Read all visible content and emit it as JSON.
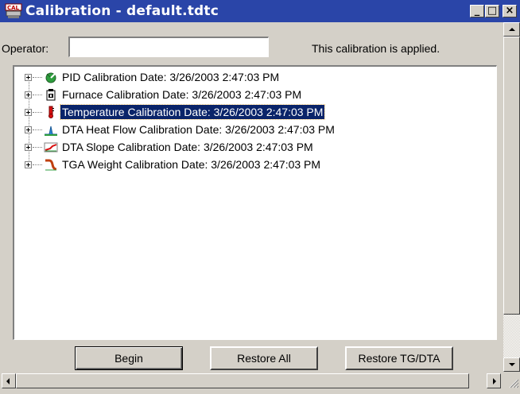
{
  "window": {
    "title": "Calibration - default.tdtc",
    "app_icon": "cal-app-icon",
    "controls": {
      "minimize": "_",
      "maximize": "□",
      "close": "×"
    }
  },
  "operator": {
    "label": "Operator:",
    "value": "",
    "placeholder": ""
  },
  "status_text": "This calibration is applied.",
  "tree": {
    "items": [
      {
        "label": "PID Calibration Date:  3/26/2003 2:47:03 PM",
        "icon": "pid-gauge-icon",
        "selected": false
      },
      {
        "label": "Furnace Calibration Date:  3/26/2003 2:47:03 PM",
        "icon": "furnace-icon",
        "selected": false
      },
      {
        "label": "Temperature Calibration Date:  3/26/2003 2:47:03 PM",
        "icon": "thermometer-icon",
        "selected": true
      },
      {
        "label": "DTA Heat Flow Calibration Date:  3/26/2003 2:47:03 PM",
        "icon": "heat-flow-icon",
        "selected": false
      },
      {
        "label": "DTA Slope Calibration Date:  3/26/2003 2:47:03 PM",
        "icon": "slope-icon",
        "selected": false
      },
      {
        "label": "TGA Weight Calibration Date:  3/26/2003 2:47:03 PM",
        "icon": "weight-curve-icon",
        "selected": false
      }
    ]
  },
  "buttons": {
    "begin": "Begin",
    "restore_all": "Restore All",
    "restore_tg_dta": "Restore TG/DTA"
  },
  "colors": {
    "titlebar": "#2a45a8",
    "selection": "#0a246a",
    "face": "#d4d0c8"
  }
}
